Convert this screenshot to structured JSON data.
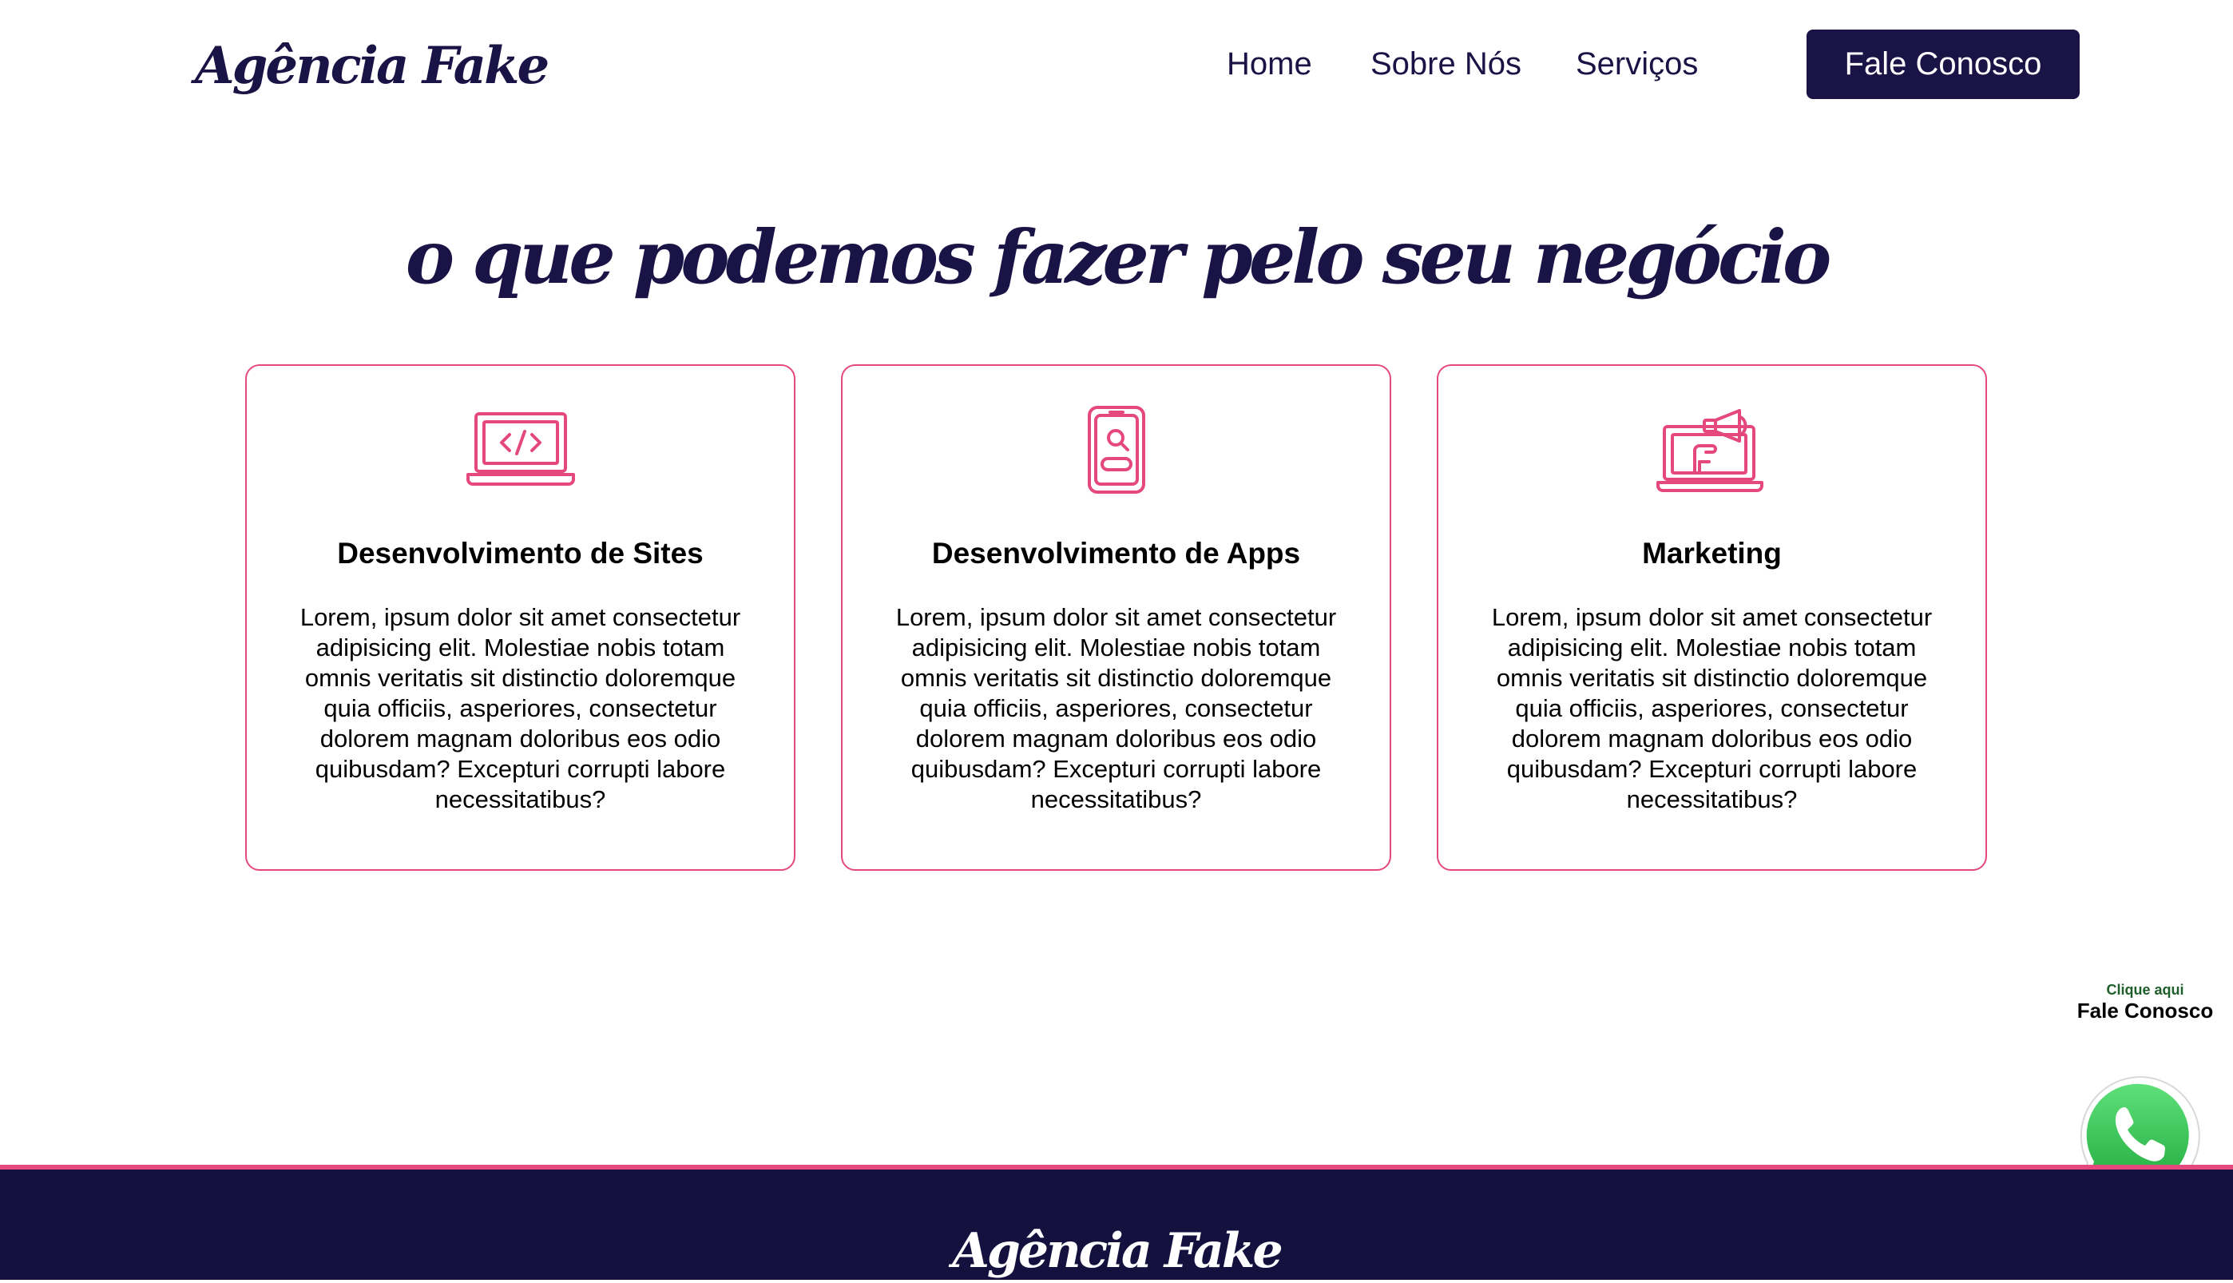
{
  "brand": {
    "name": "Agência Fake",
    "primary_color": "#1a1446",
    "accent_color": "#e5487c"
  },
  "nav": {
    "items": [
      {
        "label": "Home"
      },
      {
        "label": "Sobre Nós"
      },
      {
        "label": "Serviços"
      }
    ],
    "cta_label": "Fale Conosco"
  },
  "hero": {
    "headline": "o que podemos fazer pelo seu negócio"
  },
  "services": [
    {
      "icon": "laptop-code-icon",
      "title": "Desenvolvimento de Sites",
      "text": "Lorem, ipsum dolor sit amet consectetur adipisicing elit. Molestiae nobis totam omnis veritatis sit distinctio doloremque quia officiis, asperiores, consectetur dolorem magnam doloribus eos odio quibusdam? Excepturi corrupti labore necessitatibus?"
    },
    {
      "icon": "smartphone-search-icon",
      "title": "Desenvolvimento de Apps",
      "text": "Lorem, ipsum dolor sit amet consectetur adipisicing elit. Molestiae nobis totam omnis veritatis sit distinctio doloremque quia officiis, asperiores, consectetur dolorem magnam doloribus eos odio quibusdam? Excepturi corrupti labore necessitatibus?"
    },
    {
      "icon": "laptop-megaphone-icon",
      "title": "Marketing",
      "text": "Lorem, ipsum dolor sit amet consectetur adipisicing elit. Molestiae nobis totam omnis veritatis sit distinctio doloremque quia officiis, asperiores, consectetur dolorem magnam doloribus eos odio quibusdam? Excepturi corrupti labore necessitatibus?"
    }
  ],
  "whatsapp": {
    "small_label": "Clique aqui",
    "label": "Fale Conosco",
    "icon": "whatsapp-icon",
    "color": "#25d366"
  },
  "footer": {
    "logo": "Agência Fake"
  }
}
